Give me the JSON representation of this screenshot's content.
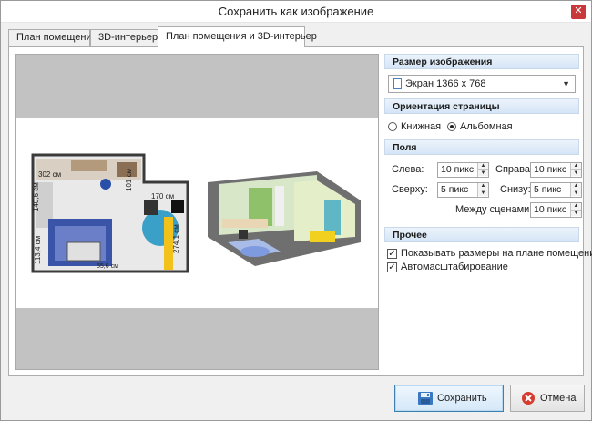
{
  "window": {
    "title": "Сохранить как изображение",
    "close_glyph": "✕"
  },
  "tabs": [
    {
      "label": "План помещения"
    },
    {
      "label": "3D-интерьер"
    },
    {
      "label": "План помещения и 3D-интерьер"
    }
  ],
  "preview": {
    "plan_dims": [
      "302 см",
      "140,6 см",
      "101 см",
      "170 см",
      "274,1 см",
      "113,4 см",
      "55,6 см"
    ]
  },
  "image_size": {
    "header": "Размер изображения",
    "selected": "Экран 1366 x 768",
    "icon": "document-icon"
  },
  "orientation": {
    "header": "Ориентация страницы",
    "portrait": "Книжная",
    "landscape": "Альбомная",
    "selected": "landscape"
  },
  "margins": {
    "header": "Поля",
    "left_label": "Слева:",
    "left_value": "10 пикс",
    "right_label": "Справа:",
    "right_value": "10 пикс",
    "top_label": "Сверху:",
    "top_value": "5 пикс",
    "bottom_label": "Снизу:",
    "bottom_value": "5 пикс",
    "between_label": "Между сценами:",
    "between_value": "10 пикс"
  },
  "other": {
    "header": "Прочее",
    "show_sizes": "Показывать размеры на плане помещения",
    "show_sizes_checked": true,
    "autoscale": "Автомасштабирование",
    "autoscale_checked": true
  },
  "buttons": {
    "save": "Сохранить",
    "cancel": "Отмена"
  },
  "colors": {
    "accent": "#3c7fb1",
    "header_bg": "#d5e5f6",
    "cancel_red": "#d63b2f"
  }
}
